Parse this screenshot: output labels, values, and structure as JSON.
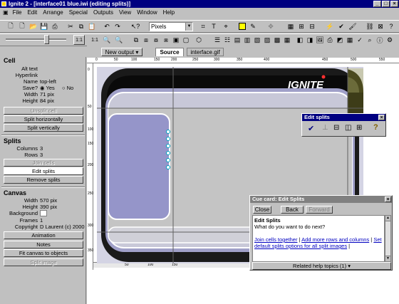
{
  "window": {
    "title": "Ignite 2 - [interface01 blue.iwi (editing splits)]"
  },
  "menu": [
    "File",
    "Edit",
    "Arrange",
    "Special",
    "Outputs",
    "View",
    "Window",
    "Help"
  ],
  "toolbar": {
    "units_value": "Pixels",
    "zoom_label": "1:1",
    "zoom_label2": "1:1"
  },
  "doc_tabs": {
    "output_button": "New output",
    "source": "Source",
    "gif": "interface.gif"
  },
  "ruler": {
    "top_ticks": [
      "0",
      "50",
      "100",
      "150",
      "200",
      "250",
      "300",
      "350",
      "400",
      "450",
      "500",
      "550"
    ],
    "left_ticks": [
      "0",
      "50",
      "100",
      "150",
      "200",
      "250",
      "300",
      "350"
    ],
    "bottom_ticks": [
      "50",
      "100",
      "150"
    ]
  },
  "cell": {
    "heading": "Cell",
    "alt_text_label": "Alt text",
    "hyperlink_label": "Hyperlink",
    "name_label": "Name",
    "name_value": "top-left",
    "save_label": "Save?",
    "save_yes": "Yes",
    "save_no": "No",
    "width_label": "Width",
    "width_value": "71 pix",
    "height_label": "Height",
    "height_value": "84 pix",
    "unsplit_button": "Unsplit cell",
    "split_h_button": "Split horizontally",
    "split_v_button": "Split vertically"
  },
  "splits": {
    "heading": "Splits",
    "columns_label": "Columns",
    "columns_value": "3",
    "rows_label": "Rows",
    "rows_value": "3",
    "join_button": "Join cells",
    "edit_button": "Edit splits",
    "remove_button": "Remove splits"
  },
  "canvas": {
    "heading": "Canvas",
    "width_label": "Width",
    "width_value": "570 pix",
    "height_label": "Height",
    "height_value": "390 pix",
    "background_label": "Background",
    "frames_label": "Frames",
    "frames_value": "1",
    "copyright_label": "Copyright",
    "copyright_value": "D Laurent (c) 2000",
    "animation_button": "Animation",
    "notes_button": "Notes",
    "fit_button": "Fit canvas to objects",
    "split_image_button": "Split image"
  },
  "edit_splits_palette": {
    "title": "Edit splits"
  },
  "help_window": {
    "title": "Cue card: Edit Splits",
    "close_button": "Close",
    "back_button": "Back",
    "forward_button": "Forward",
    "heading": "Edit Splits",
    "question": "What do you want to do next?",
    "link_join": "Join cells together",
    "link_add": "Add more rows and columns",
    "link_default": "Set default splits options for all split images",
    "related": "Related help topics (1)"
  },
  "logo_text": "IGNITE",
  "colors": {
    "title_blue": "#000080",
    "canvas_purple": "#9595c9",
    "olive": "#4b4a1e",
    "link": "#0000c0"
  }
}
